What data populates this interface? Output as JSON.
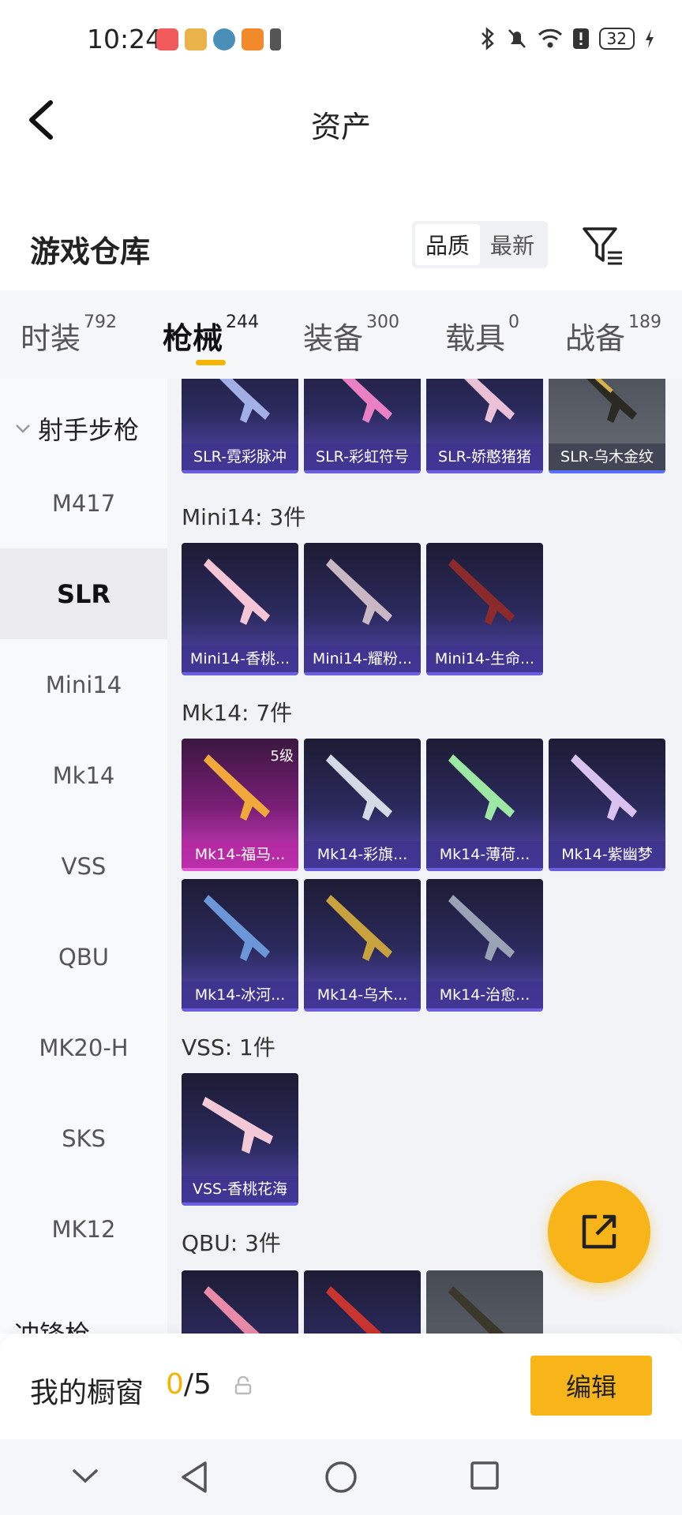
{
  "status_bar": {
    "time": "10:24",
    "battery": "32",
    "icons": [
      "bluetooth-icon",
      "mute-icon",
      "wifi-icon",
      "alert-icon",
      "battery-icon",
      "charging-icon"
    ]
  },
  "header": {
    "title": "资产"
  },
  "section": {
    "title": "游戏仓库",
    "sort_options": [
      "品质",
      "最新"
    ],
    "sort_active": "品质"
  },
  "tabs": [
    {
      "label": "时装",
      "count": "792"
    },
    {
      "label": "枪械",
      "count": "244",
      "active": true
    },
    {
      "label": "装备",
      "count": "300"
    },
    {
      "label": "载具",
      "count": "0"
    },
    {
      "label": "战备",
      "count": "189"
    }
  ],
  "sidenav": {
    "group": "射手步枪",
    "items": [
      "M417",
      "SLR",
      "Mini14",
      "Mk14",
      "VSS",
      "QBU",
      "MK20-H",
      "SKS",
      "MK12"
    ],
    "active": "SLR",
    "next_group": "冲锋枪"
  },
  "content": {
    "slr_cards": [
      "SLR-霓彩脉冲",
      "SLR-彩虹符号",
      "SLR-娇憨猪猪",
      "SLR-乌木金纹"
    ],
    "mini14": {
      "label": "Mini14: 3件",
      "cards": [
        "Mini14-香桃...",
        "Mini14-耀粉...",
        "Mini14-生命..."
      ]
    },
    "mk14": {
      "label": "Mk14: 7件",
      "cards": [
        "Mk14-福马...",
        "Mk14-彩旗...",
        "Mk14-薄荷...",
        "Mk14-紫幽梦",
        "Mk14-冰河...",
        "Mk14-乌木...",
        "Mk14-治愈..."
      ],
      "level_badge": "5级"
    },
    "vss": {
      "label": "VSS: 1件",
      "cards": [
        "VSS-香桃花海"
      ]
    },
    "qbu": {
      "label": "QBU: 3件"
    }
  },
  "bottom_bar": {
    "label": "我的橱窗",
    "count_current": "0",
    "count_total": "/5",
    "edit_label": "编辑"
  }
}
